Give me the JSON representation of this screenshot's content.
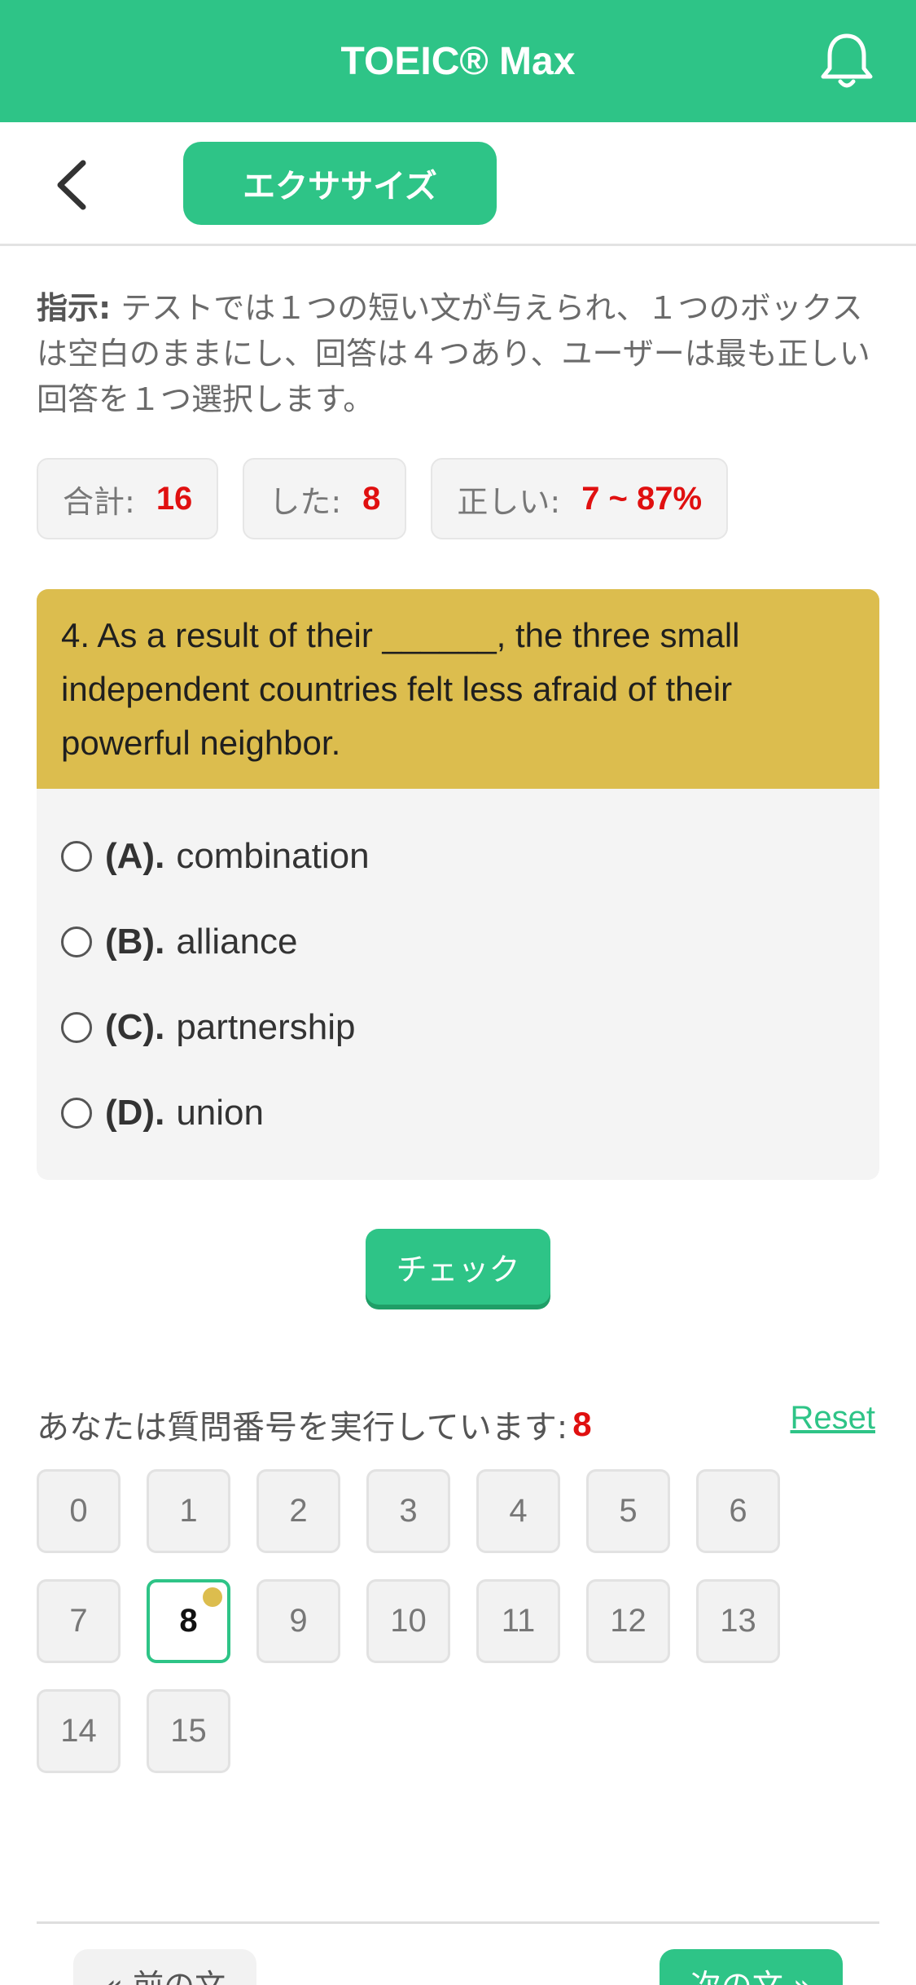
{
  "header": {
    "title": "TOEIC® Max",
    "bell_icon": "bell-icon"
  },
  "subbar": {
    "back_icon": "chevron-left-icon",
    "tab_label": "エクササイズ"
  },
  "instructions": {
    "label": "指示:",
    "text": " テストでは１つの短い文が与えられ、１つのボックスは空白のままにし、回答は４つあり、ユーザーは最も正しい回答を１つ選択します。"
  },
  "stats": {
    "total_label": "合計:",
    "total_value": "16",
    "done_label": "した:",
    "done_value": "8",
    "correct_label": "正しい:",
    "correct_value": "7 ~ 87%"
  },
  "question": {
    "text": "4. As a result of their ______, the three small independent countries felt less afraid of their powerful neighbor.",
    "options": [
      {
        "letter": "(A).",
        "text": "combination"
      },
      {
        "letter": "(B).",
        "text": "alliance"
      },
      {
        "letter": "(C).",
        "text": "partnership"
      },
      {
        "letter": "(D).",
        "text": "union"
      }
    ]
  },
  "check_button": "チェック",
  "progress": {
    "label": "あなたは質問番号を実行しています:",
    "current": "8",
    "reset": "Reset"
  },
  "question_numbers": [
    "0",
    "1",
    "2",
    "3",
    "4",
    "5",
    "6",
    "7",
    "8",
    "9",
    "10",
    "11",
    "12",
    "13",
    "14",
    "15"
  ],
  "nav": {
    "prev": "« 前の文",
    "next": "次の文 »"
  },
  "colors": {
    "accent": "#2ec487",
    "question_bg": "#dcbd4e",
    "highlight_red": "#e01010"
  }
}
